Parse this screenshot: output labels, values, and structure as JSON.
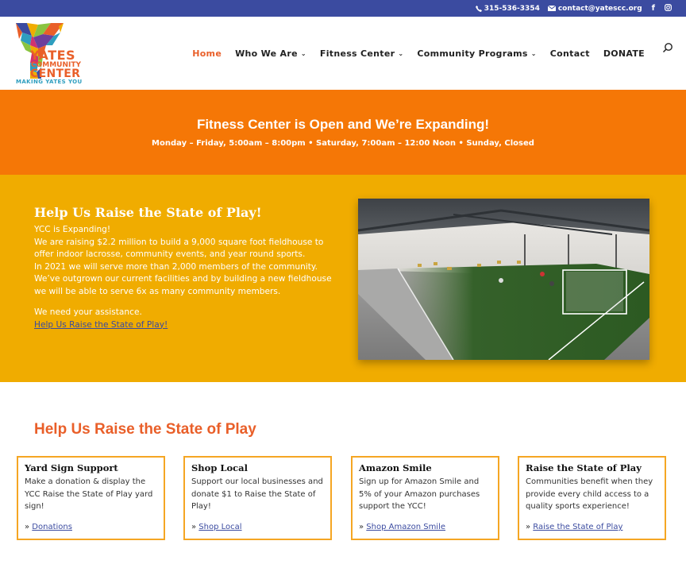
{
  "topbar": {
    "phone": "315-536-3354",
    "email": "contact@yatescc.org",
    "icons": [
      "phone-icon",
      "email-icon",
      "facebook-icon",
      "instagram-icon"
    ]
  },
  "logo": {
    "line1": "YATES",
    "line2": "COMMUNITY",
    "line3": "CENTER",
    "tagline": "MAKING YATES YOU"
  },
  "nav": {
    "items": [
      {
        "label": "Home",
        "active": true,
        "dropdown": false
      },
      {
        "label": "Who We Are",
        "active": false,
        "dropdown": true
      },
      {
        "label": "Fitness Center",
        "active": false,
        "dropdown": true
      },
      {
        "label": "Community Programs",
        "active": false,
        "dropdown": true
      },
      {
        "label": "Contact",
        "active": false,
        "dropdown": false
      },
      {
        "label": "DONATE",
        "active": false,
        "dropdown": false
      }
    ],
    "chevron": "⌄"
  },
  "banner": {
    "title": "Fitness Center is Open and We’re Expanding!",
    "hours": "Monday – Friday, 5:00am – 8:00pm • Saturday, 7:00am – 12:00 Noon • Sunday, Closed"
  },
  "feature": {
    "title": "Help Us Raise the State of Play!",
    "line1": "YCC is Expanding!",
    "para1": "We are raising $2.2 million to build a 9,000 square foot fieldhouse to offer indoor lacrosse, community events, and year round sports.",
    "para2": "In 2021 we will serve more than 2,000 members of the community. We’ve outgrown our current facilities and by building a new fieldhouse we will be able to serve 6x as many community members.",
    "assist": "We need your assistance.",
    "link": "Help Us Raise the State of Play!",
    "image_alt": "Rendering of indoor fieldhouse with turf soccer field"
  },
  "section": {
    "title": "Help Us Raise the State of Play",
    "cards": [
      {
        "title": "Yard Sign Support",
        "text": "Make a donation & display the YCC Raise the State of Play yard sign!",
        "prefix": "» ",
        "link": "Donations"
      },
      {
        "title": "Shop Local",
        "text": "Support our local businesses and donate $1 to Raise the State of Play!",
        "prefix": "» ",
        "link": "Shop Local"
      },
      {
        "title": "Amazon Smile",
        "text": "Sign up for Amazon Smile and 5% of your Amazon purchases support the YCC!",
        "prefix": "» ",
        "link": "Shop Amazon Smile"
      },
      {
        "title": "Raise the State of Play",
        "text": "Communities benefit when they provide every child access to a quality sports experience!",
        "prefix": "» ",
        "link": "Raise the State of Play"
      }
    ]
  },
  "colors": {
    "topbar": "#3b4ba0",
    "orange": "#f57706",
    "yellow": "#f0ac00",
    "accent": "#e95f29",
    "card_border": "#f5a623",
    "link": "#3b4ba0"
  }
}
